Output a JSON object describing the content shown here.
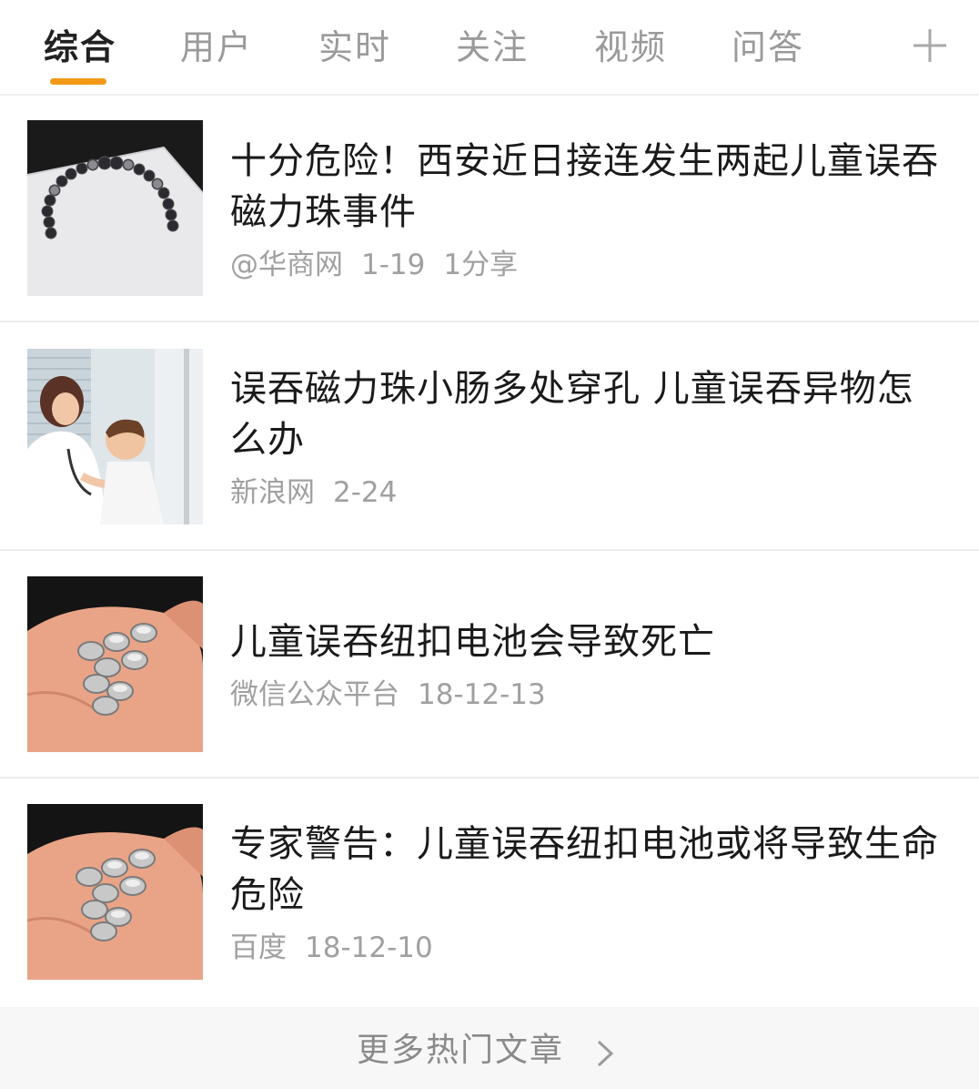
{
  "tabs": [
    {
      "label": "综合",
      "active": true
    },
    {
      "label": "用户",
      "active": false
    },
    {
      "label": "实时",
      "active": false
    },
    {
      "label": "关注",
      "active": false
    },
    {
      "label": "视频",
      "active": false
    },
    {
      "label": "问答",
      "active": false
    }
  ],
  "add_tab_icon": "plus-icon",
  "accent_color": "#f29a18",
  "articles": [
    {
      "title": "十分危险！西安近日接连发生两起儿童误吞磁力珠事件",
      "source": "@华商网",
      "date": "1-19",
      "shares": "1分享",
      "thumbnail": "magnetic-beads-image"
    },
    {
      "title": "误吞磁力珠小肠多处穿孔 儿童误吞异物怎么办",
      "source": "新浪网",
      "date": "2-24",
      "thumbnail": "doctor-child-image"
    },
    {
      "title": "儿童误吞纽扣电池会导致死亡",
      "source": "微信公众平台",
      "date": "18-12-13",
      "thumbnail": "button-batteries-image"
    },
    {
      "title": "专家警告：儿童误吞纽扣电池或将导致生命危险",
      "source": "百度",
      "date": "18-12-10",
      "thumbnail": "button-batteries-image"
    }
  ],
  "more_articles": {
    "label": "更多热门文章",
    "icon": "chevron-right-icon"
  }
}
